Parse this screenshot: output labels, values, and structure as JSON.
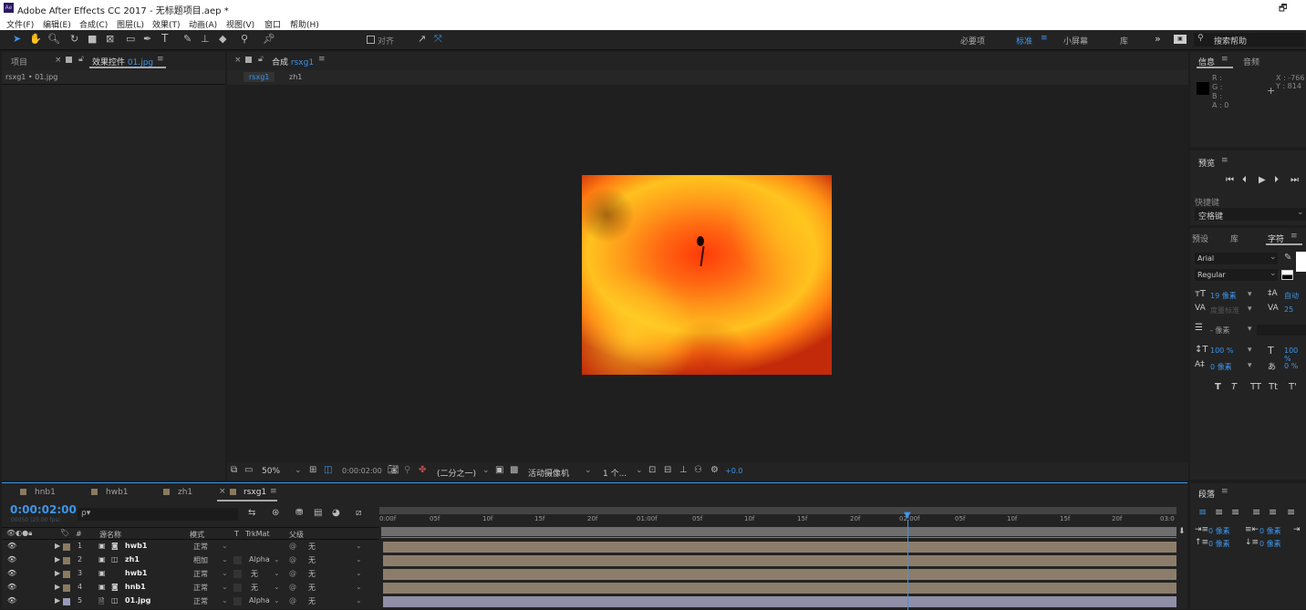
{
  "window": {
    "title": "Adobe After Effects CC 2017 - 无标题项目.aep *",
    "restore_glyph": "🗗",
    "min_glyph": "–"
  },
  "menu": [
    "文件(F)",
    "编辑(E)",
    "合成(C)",
    "图层(L)",
    "效果(T)",
    "动画(A)",
    "视图(V)",
    "窗口",
    "帮助(H)"
  ],
  "toolbar": {
    "align_label": "对齐",
    "workspaces": [
      "必要项",
      "标准",
      "小屏幕",
      "库"
    ],
    "active_workspace": "标准",
    "search_placeholder": "搜索帮助",
    "more": "»"
  },
  "left_panel": {
    "tab_project": "项目",
    "tab_effects": "效果控件",
    "effects_file": "01.jpg",
    "breadcrumb": "rsxg1 • 01.jpg"
  },
  "comp_panel": {
    "tab_label": "合成",
    "comp_name": "rsxg1",
    "sub_tabs": [
      "rsxg1",
      "zh1"
    ],
    "zoom": "50%",
    "timecode": "0:00:02:00",
    "resolution": "(二分之一)",
    "camera": "活动摄像机",
    "views": "1 个...",
    "exposure": "+0.0"
  },
  "info_panel": {
    "tab_info": "信息",
    "tab_audio": "音频",
    "r": "R :",
    "g": "G :",
    "b": "B :",
    "a": "A : 0",
    "x": "X : -766",
    "y": "Y : 814"
  },
  "preview_panel": {
    "title": "预览",
    "shortcut_label": "快捷键",
    "shortcut_value": "空格键"
  },
  "character_panel": {
    "tab_effects": "预设",
    "tab_library": "库",
    "tab_char": "字符",
    "font": "Arial",
    "style": "Regular",
    "size": "19 像素",
    "leading": "自动",
    "kerning": "度量标准",
    "tracking": "25",
    "stroke": "- 像素",
    "vscale": "100 %",
    "hscale": "100 %",
    "baseline": "0 像素",
    "tsume": "0 %",
    "styles": [
      "T",
      "T",
      "TT",
      "Tt",
      "T'"
    ]
  },
  "paragraph_panel": {
    "title": "段落",
    "indent1": "0 像素",
    "indent2": "0 像素",
    "indent3": "0 像素",
    "space1": "0 像素",
    "space2": "0 像素"
  },
  "timeline": {
    "tabs": [
      "hnb1",
      "hwb1",
      "zh1",
      "rsxg1"
    ],
    "active_tab": "rsxg1",
    "timecode": "0:00:02:00",
    "fps_note": "00050 (25.00 fps)",
    "search_placeholder": "ρ▾",
    "headers": {
      "num": "#",
      "name": "源名称",
      "mode": "模式",
      "t": "T",
      "trkmat": "TrkMat",
      "parent": "父级"
    },
    "ruler": [
      "0:00f",
      "05f",
      "10f",
      "15f",
      "20f",
      "01:00f",
      "05f",
      "10f",
      "15f",
      "20f",
      "02:00f",
      "05f",
      "10f",
      "15f",
      "20f",
      "03:0"
    ],
    "layers": [
      {
        "num": "1",
        "name": "hwb1",
        "mode": "正常",
        "trkmat": "",
        "parent": "无"
      },
      {
        "num": "2",
        "name": "zh1",
        "mode": "相加",
        "trkmat": "Alpha",
        "parent": "无"
      },
      {
        "num": "3",
        "name": "hwb1",
        "mode": "正常",
        "trkmat": "无",
        "parent": "无"
      },
      {
        "num": "4",
        "name": "hnb1",
        "mode": "正常",
        "trkmat": "无",
        "parent": "无"
      },
      {
        "num": "5",
        "name": "01.jpg",
        "mode": "正常",
        "trkmat": "Alpha",
        "parent": "无"
      }
    ]
  },
  "colors": {
    "accent": "#3e95e8",
    "panel": "#232323",
    "bg": "#1d1d1d",
    "layer_bar": "#8c7d6b",
    "playhead": "#3e95e8"
  }
}
